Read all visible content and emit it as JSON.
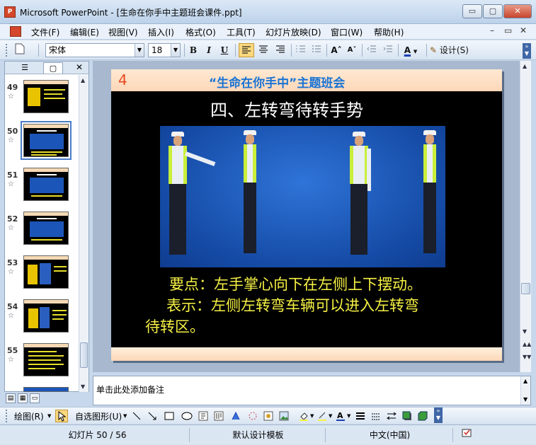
{
  "window": {
    "title": "Microsoft PowerPoint - [生命在你手中主题班会课件.ppt]",
    "app_icon": "P",
    "buttons": {
      "minimize": "▭",
      "maximize": "▢",
      "close": "✕"
    }
  },
  "menu": {
    "items": [
      "文件(F)",
      "编辑(E)",
      "视图(V)",
      "插入(I)",
      "格式(O)",
      "工具(T)",
      "幻灯片放映(D)",
      "窗口(W)",
      "帮助(H)"
    ],
    "doc_controls": [
      "–",
      "▭",
      "✕"
    ]
  },
  "format_toolbar": {
    "font_name": "宋体",
    "font_size": "18",
    "bold": "B",
    "italic": "I",
    "underline": "U",
    "design_label": "设计(S)",
    "font_color_label": "A",
    "grow_font": "A˄",
    "shrink_font": "A˅"
  },
  "left_pane": {
    "tabs": [
      "☰",
      "▢"
    ],
    "close": "✕",
    "slides": [
      {
        "num": "49",
        "star": "☆"
      },
      {
        "num": "50",
        "star": "☆"
      },
      {
        "num": "51",
        "star": "☆"
      },
      {
        "num": "52",
        "star": "☆"
      },
      {
        "num": "53",
        "star": "☆"
      },
      {
        "num": "54",
        "star": "☆"
      },
      {
        "num": "55",
        "star": "☆"
      }
    ]
  },
  "slide": {
    "page_number": "4",
    "header_title": "“生命在你手中”主题班会",
    "title": "四、左转弯待转手势",
    "body": {
      "line1": "要点：左手掌心向下在左侧上下摆动。",
      "line2": "表示：左侧左转弯车辆可以进入左转弯",
      "line3": "待转区。"
    }
  },
  "notes": {
    "placeholder": "单击此处添加备注"
  },
  "drawing_toolbar": {
    "draw_label": "绘图(R)",
    "autoshape_label": "自选图形(U)"
  },
  "status_bar": {
    "slide_position": "幻灯片 50 / 56",
    "template": "默认设计模板",
    "language": "中文(中国)"
  },
  "colors": {
    "slide_bg": "#000000",
    "header_title": "#1a73d4",
    "page_number": "#e8461e",
    "body_text": "#f7f244",
    "photo_bg": "#1c55b8",
    "vest": "#c9ef3a"
  }
}
